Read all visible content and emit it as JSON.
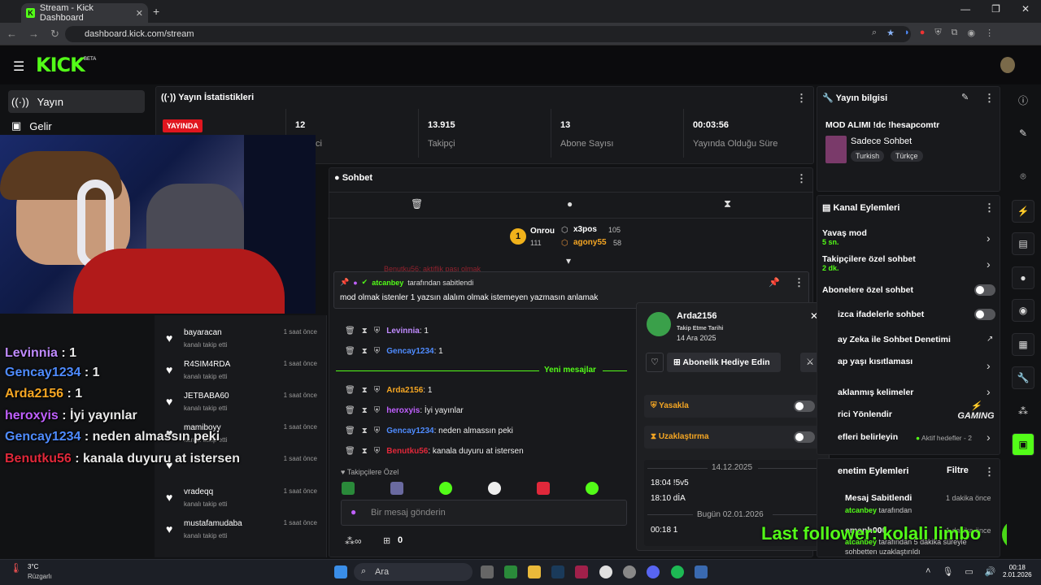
{
  "browser": {
    "tab_title": "Stream - Kick Dashboard",
    "url": "dashboard.kick.com/stream",
    "new_tab": "+",
    "close": "✕"
  },
  "kick": {
    "logo": "KICK",
    "beta": "BETA"
  },
  "left_nav": [
    {
      "label": "Yayın",
      "icon": "broadcast-icon"
    },
    {
      "label": "Gelir",
      "icon": "wallet-icon"
    }
  ],
  "overlay_chat": [
    {
      "user": "Levinnia",
      "sep": " : ",
      "text": "1",
      "color": "#c08bff"
    },
    {
      "user": "Gencay1234",
      "sep": " : ",
      "text": "1",
      "color": "#4f8cff"
    },
    {
      "user": "Arda2156",
      "sep": " : ",
      "text": "1",
      "color": "#f5a623"
    },
    {
      "user": "heroxyis",
      "sep": " : ",
      "text": "İyi yayınlar",
      "color": "#c060ff"
    },
    {
      "user": "Gencay1234",
      "sep": " : ",
      "text": "neden almassın peki",
      "color": "#4f8cff"
    },
    {
      "user": "Benutku56",
      "sep": " : ",
      "text": "kanala duyuru at istersen",
      "color": "#e0283a"
    }
  ],
  "stats": {
    "title": "Yayın İstatistikleri",
    "live_badge": "YAYINDA",
    "items": [
      {
        "value": "12",
        "label": "İzleyici"
      },
      {
        "value": "13.915",
        "label": "Takipçi"
      },
      {
        "value": "13",
        "label": "Abone Sayısı"
      },
      {
        "value": "00:03:56",
        "label": "Yayında Olduğu Süre"
      }
    ]
  },
  "chat": {
    "title": "Sohbet",
    "leaderboard": [
      {
        "name": "Onrou",
        "score": "111"
      },
      {
        "name": "x3pos",
        "score": "105"
      },
      {
        "name": "agony55",
        "score": "58"
      }
    ],
    "hidden_line": "Benutku56: aktiflik pası olmak",
    "pinned_by_user": "atcanbey",
    "pinned_by_suffix": "tarafından sabitlendi",
    "pinned_text": "mod olmak istenler 1 yazsın alalım olmak istemeyen yazmasın anlamak",
    "messages_top": [
      {
        "user": "Levinnia",
        "text": ": 1",
        "color": "#c08bff"
      },
      {
        "user": "Gencay1234",
        "text": ": 1",
        "color": "#4f8cff"
      }
    ],
    "new_messages_label": "Yeni mesajlar",
    "messages_bottom": [
      {
        "user": "Arda2156",
        "text": ": 1",
        "color": "#f5a623"
      },
      {
        "user": "heroxyis",
        "text": ": İyi yayınlar",
        "color": "#c060ff"
      },
      {
        "user": "Gencay1234",
        "text": ": neden almassın peki",
        "color": "#4f8cff"
      },
      {
        "user": "Benutku56",
        "text": ": kanala duyuru at istersen",
        "color": "#e0283a"
      }
    ],
    "followers_only_label": "Takipçilere Özel",
    "input_placeholder": "Bir mesaj gönderin",
    "points": "0"
  },
  "followers": [
    {
      "name": "bayaracan",
      "sub": "kanalı takip etti",
      "time": "1 saat önce"
    },
    {
      "name": "R4SIM4RDA",
      "sub": "kanalı takip etti",
      "time": "1 saat önce"
    },
    {
      "name": "JETBABA60",
      "sub": "kanalı takip etti",
      "time": "1 saat önce"
    },
    {
      "name": "mamiboyy",
      "sub": "kanalı takip etti",
      "time": "1 saat önce"
    },
    {
      "name": "",
      "sub": "",
      "time": "1 saat önce"
    },
    {
      "name": "vradeqq",
      "sub": "kanalı takip etti",
      "time": "1 saat önce"
    },
    {
      "name": "mustafamudaba",
      "sub": "kanalı takip etti",
      "time": "1 saat önce"
    }
  ],
  "popup": {
    "username": "Arda2156",
    "follow_label": "Takip Etme Tarihi",
    "follow_date": "14 Ara 2025",
    "gift_label": "Abonelik Hediye Edin",
    "ban_label": "Yasakla",
    "timeout_label": "Uzaklaştırma",
    "date1": "14.12.2025",
    "msg1": "18:04 !5v5",
    "msg2": "18:10 dİA",
    "date2": "Bugün 02.01.2026",
    "msg3": "00:18 1"
  },
  "stream_info": {
    "title": "Yayın bilgisi",
    "stream_title": "MOD ALIMI !dc !hesapcomtr",
    "category": "Sadece Sohbet",
    "tags": [
      "Turkish",
      "Türkçe"
    ]
  },
  "channel_actions": {
    "title": "Kanal Eylemleri",
    "rows": [
      {
        "label": "Yavaş mod",
        "sub": "5 sn."
      },
      {
        "label": "Takipçilere özel sohbet",
        "sub": "2 dk."
      },
      {
        "label": "Abonelere özel sohbet",
        "sub": ""
      },
      {
        "label": "izca ifadelerle sohbet",
        "sub": ""
      },
      {
        "label": "ay Zeka ile Sohbet Denetimi",
        "sub": ""
      },
      {
        "label": "ap yaşı kısıtlaması",
        "sub": ""
      },
      {
        "label": "aklanmış kelimeler",
        "sub": ""
      },
      {
        "label": "rici Yönlendir",
        "sub": ""
      },
      {
        "label": "efleri belirleyin",
        "sub": "Aktif hedefler - 2"
      }
    ]
  },
  "mod_actions": {
    "title": "enetim Eylemleri",
    "filter": "Filtre",
    "item_title": "Mesaj Sabitlendi",
    "item_time": "1 dakika önce",
    "item_user": "atcanbey",
    "item_suffix": "tarafından",
    "item2_title": "emanh000",
    "item2_time": "1 dakika önce",
    "item2_user": "atcanbey",
    "item2_text": "tarafından 5 dakika süreyle",
    "item3_text": "sohbetten uzaklaştırıldı"
  },
  "overlay_last_follow": "Last follower: kolali limbo",
  "gaming_logo": "GAMING",
  "weather": {
    "temp": "3°C",
    "desc": "Rüzgarlı"
  },
  "taskbar": {
    "search": "Ara",
    "time": "00:18",
    "date": "2.01.2026"
  }
}
